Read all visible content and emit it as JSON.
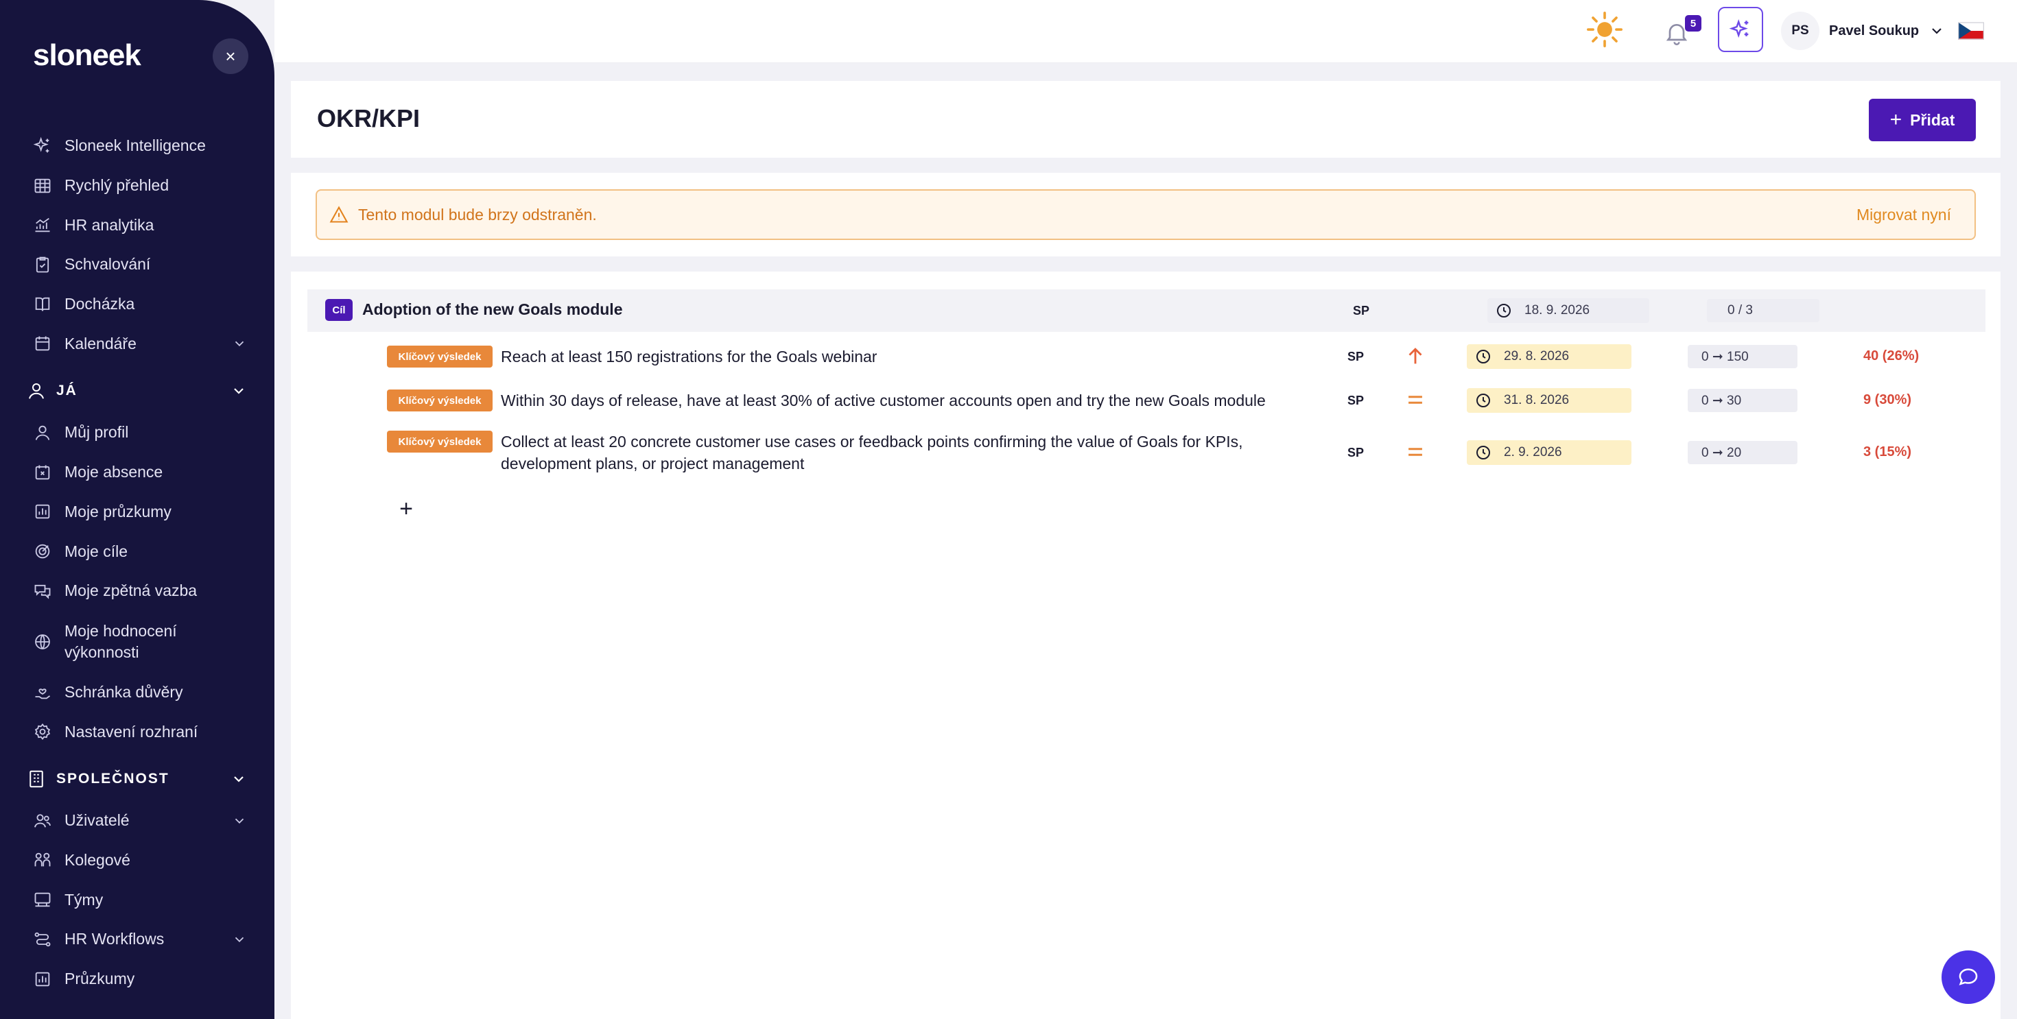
{
  "brand": {
    "logo_text": "sloneek"
  },
  "sidebar": {
    "close_glyph": "×",
    "items_top": [
      {
        "label": "Sloneek Intelligence",
        "icon": "sparkles-icon"
      },
      {
        "label": "Rychlý přehled",
        "icon": "grid-icon"
      },
      {
        "label": "HR analytika",
        "icon": "chart-icon"
      },
      {
        "label": "Schvalování",
        "icon": "clipboard-check-icon"
      },
      {
        "label": "Docházka",
        "icon": "book-icon"
      },
      {
        "label": "Kalendáře",
        "icon": "calendar-icon",
        "expandable": true
      }
    ],
    "section_me": {
      "label": "JÁ",
      "icon": "user-icon"
    },
    "items_me": [
      {
        "label": "Můj profil",
        "icon": "user-icon"
      },
      {
        "label": "Moje absence",
        "icon": "calendar-x-icon"
      },
      {
        "label": "Moje průzkumy",
        "icon": "bar-chart-icon"
      },
      {
        "label": "Moje cíle",
        "icon": "target-icon"
      },
      {
        "label": "Moje zpětná vazba",
        "icon": "chat-bubbles-icon"
      },
      {
        "label": "Moje hodnocení výkonnosti",
        "icon": "globe-icon"
      },
      {
        "label": "Schránka důvěry",
        "icon": "hand-heart-icon"
      },
      {
        "label": "Nastavení rozhraní",
        "icon": "settings-icon"
      }
    ],
    "section_company": {
      "label": "SPOLEČNOST",
      "icon": "building-icon"
    },
    "items_company": [
      {
        "label": "Uživatelé",
        "icon": "users-icon",
        "expandable": true
      },
      {
        "label": "Kolegové",
        "icon": "colleagues-icon"
      },
      {
        "label": "Týmy",
        "icon": "team-icon"
      },
      {
        "label": "HR Workflows",
        "icon": "workflow-icon",
        "expandable": true
      },
      {
        "label": "Průzkumy",
        "icon": "survey-icon"
      }
    ]
  },
  "topbar": {
    "notification_count": "5",
    "user_initials": "PS",
    "user_name": "Pavel Soukup",
    "theme_icon": "sun-icon",
    "language_flag": "czech-flag-icon"
  },
  "page": {
    "title": "OKR/KPI",
    "add_button_label": "Přidat"
  },
  "warning": {
    "text": "Tento modul bude brzy odstraněn.",
    "link": "Migrovat nyní"
  },
  "goal": {
    "tag": "Cíl",
    "title": "Adoption of the new Goals module",
    "owner": "SP",
    "date": "18. 9. 2026",
    "progress": "0 / 3",
    "key_results": [
      {
        "tag": "Klíčový výsledek",
        "text": "Reach at least 150 registrations for the Goals webinar",
        "owner": "SP",
        "trend": "up",
        "date": "29. 8. 2026",
        "range": "0 ➞ 150",
        "percent": "40 (26%)"
      },
      {
        "tag": "Klíčový výsledek",
        "text": "Within 30 days of release, have at least 30% of active customer accounts open and try the new Goals module",
        "owner": "SP",
        "trend": "equal",
        "date": "31. 8. 2026",
        "range": "0 ➞ 30",
        "percent": "9 (30%)"
      },
      {
        "tag": "Klíčový výsledek",
        "text": "Collect at least 20 concrete customer use cases or feedback points confirming the value of Goals for KPIs, development plans, or project management",
        "owner": "SP",
        "trend": "equal",
        "date": "2. 9. 2026",
        "range": "0 ➞ 20",
        "percent": "3 (15%)"
      }
    ],
    "add_glyph": "+"
  },
  "colors": {
    "sidebar_bg": "#16143d",
    "brand_purple": "#4b19b3",
    "key_result_orange": "#e8883a",
    "warning_text": "#d1741b",
    "percent_red": "#d84a3a",
    "chat_blue": "#4b32e6"
  }
}
